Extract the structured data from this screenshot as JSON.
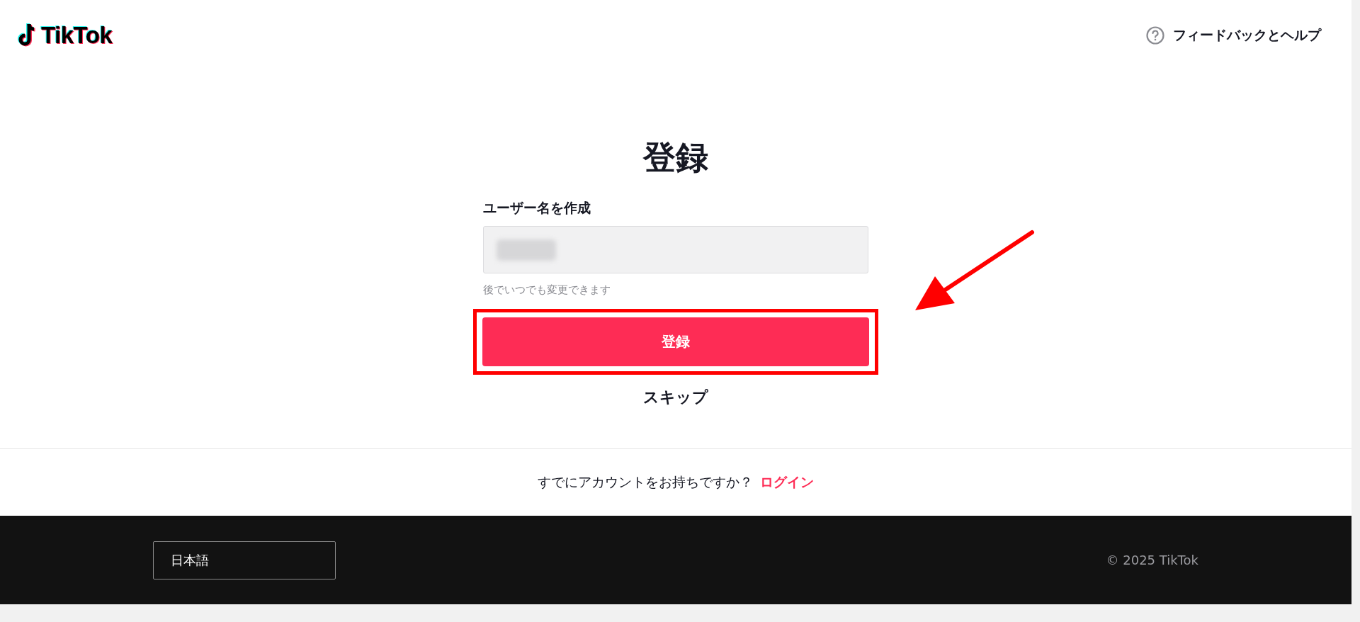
{
  "header": {
    "logo": "TikTok",
    "help_link": "フィードバックとヘルプ"
  },
  "form": {
    "title": "登録",
    "field_label": "ユーザー名を作成",
    "field_hint": "後でいつでも変更できます",
    "submit_button": "登録",
    "skip_link": "スキップ"
  },
  "login_prompt": {
    "text": "すでにアカウントをお持ちですか？",
    "link": "ログイン"
  },
  "footer": {
    "language": "日本語",
    "copyright": "© 2025 TikTok"
  }
}
